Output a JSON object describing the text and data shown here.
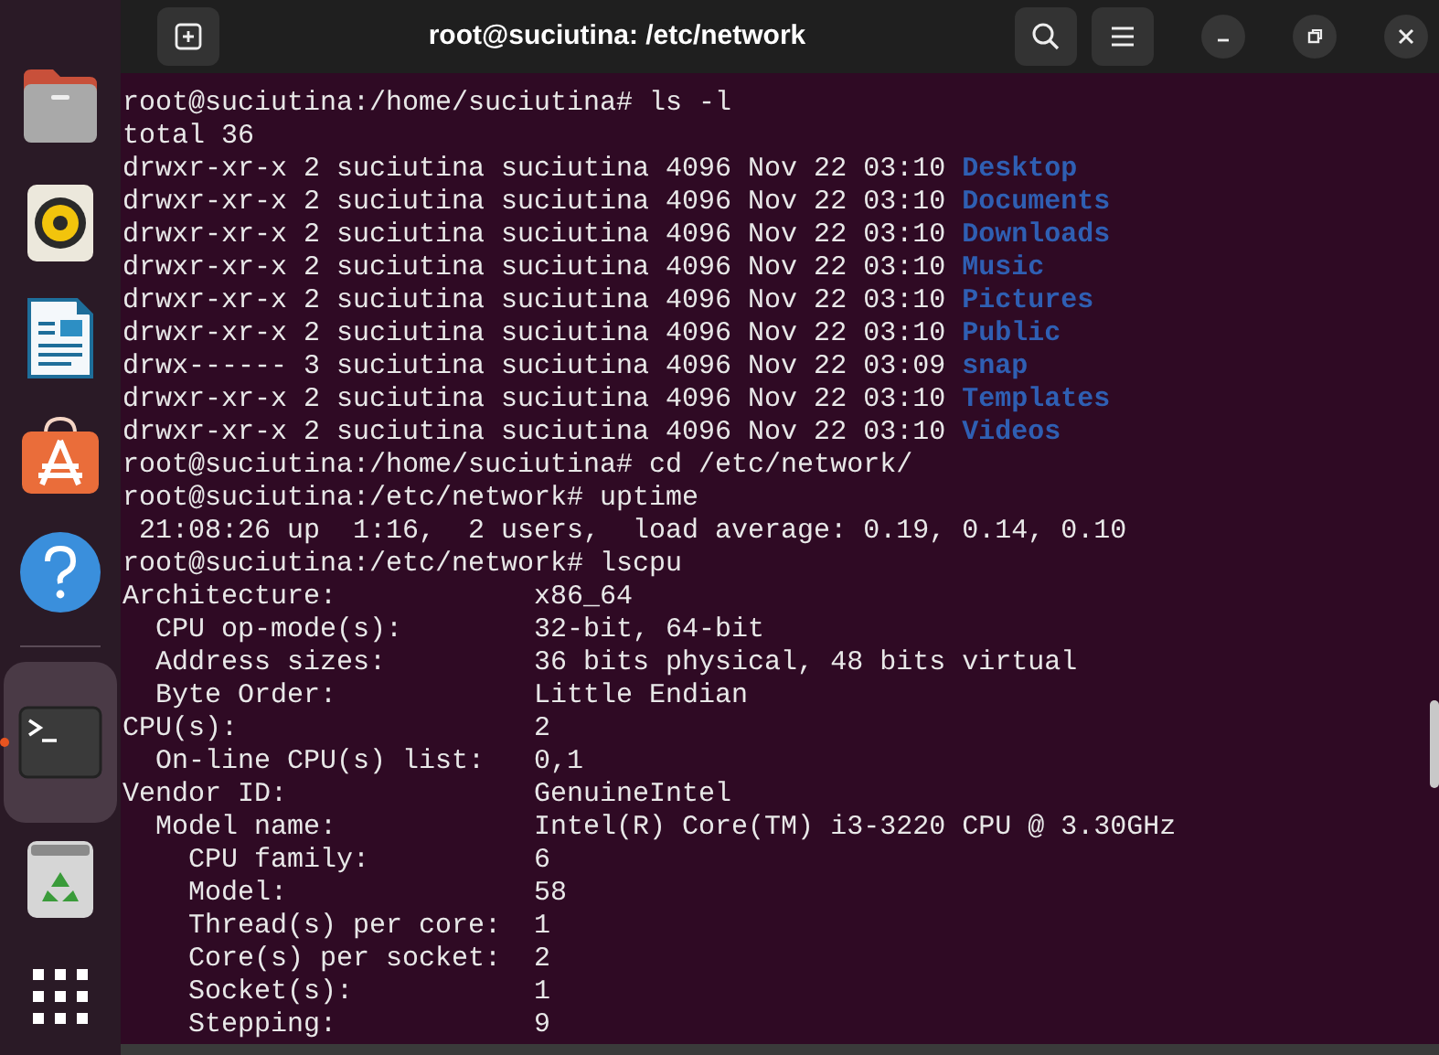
{
  "window": {
    "title": "root@suciutina: /etc/network"
  },
  "dock": [
    {
      "kind": "files",
      "selected": false
    },
    {
      "kind": "music",
      "selected": false
    },
    {
      "kind": "writer",
      "selected": false
    },
    {
      "kind": "store",
      "selected": false
    },
    {
      "kind": "help",
      "selected": false
    },
    {
      "kind": "separator"
    },
    {
      "kind": "terminal",
      "selected": true
    },
    {
      "kind": "trash",
      "selected": false
    },
    {
      "kind": "apps",
      "selected": false
    }
  ],
  "terminal": {
    "lines": [
      [
        {
          "text": "root@suciutina:/home/suciutina# ls -l",
          "kind": "plain"
        }
      ],
      [
        {
          "text": "total 36",
          "kind": "plain"
        }
      ],
      [
        {
          "text": "drwxr-xr-x 2 suciutina suciutina 4096 Nov 22 03:10 ",
          "kind": "plain"
        },
        {
          "text": "Desktop",
          "kind": "directory"
        }
      ],
      [
        {
          "text": "drwxr-xr-x 2 suciutina suciutina 4096 Nov 22 03:10 ",
          "kind": "plain"
        },
        {
          "text": "Documents",
          "kind": "directory"
        }
      ],
      [
        {
          "text": "drwxr-xr-x 2 suciutina suciutina 4096 Nov 22 03:10 ",
          "kind": "plain"
        },
        {
          "text": "Downloads",
          "kind": "directory"
        }
      ],
      [
        {
          "text": "drwxr-xr-x 2 suciutina suciutina 4096 Nov 22 03:10 ",
          "kind": "plain"
        },
        {
          "text": "Music",
          "kind": "directory"
        }
      ],
      [
        {
          "text": "drwxr-xr-x 2 suciutina suciutina 4096 Nov 22 03:10 ",
          "kind": "plain"
        },
        {
          "text": "Pictures",
          "kind": "directory"
        }
      ],
      [
        {
          "text": "drwxr-xr-x 2 suciutina suciutina 4096 Nov 22 03:10 ",
          "kind": "plain"
        },
        {
          "text": "Public",
          "kind": "directory"
        }
      ],
      [
        {
          "text": "drwx------ 3 suciutina suciutina 4096 Nov 22 03:09 ",
          "kind": "plain"
        },
        {
          "text": "snap",
          "kind": "directory"
        }
      ],
      [
        {
          "text": "drwxr-xr-x 2 suciutina suciutina 4096 Nov 22 03:10 ",
          "kind": "plain"
        },
        {
          "text": "Templates",
          "kind": "directory"
        }
      ],
      [
        {
          "text": "drwxr-xr-x 2 suciutina suciutina 4096 Nov 22 03:10 ",
          "kind": "plain"
        },
        {
          "text": "Videos",
          "kind": "directory"
        }
      ],
      [
        {
          "text": "root@suciutina:/home/suciutina# cd /etc/network/",
          "kind": "plain"
        }
      ],
      [
        {
          "text": "root@suciutina:/etc/network# uptime",
          "kind": "plain"
        }
      ],
      [
        {
          "text": " 21:08:26 up  1:16,  2 users,  load average: 0.19, 0.14, 0.10",
          "kind": "plain"
        }
      ],
      [
        {
          "text": "root@suciutina:/etc/network# lscpu",
          "kind": "plain"
        }
      ],
      [
        {
          "text": "Architecture:            x86_64",
          "kind": "plain"
        }
      ],
      [
        {
          "text": "  CPU op-mode(s):        32-bit, 64-bit",
          "kind": "plain"
        }
      ],
      [
        {
          "text": "  Address sizes:         36 bits physical, 48 bits virtual",
          "kind": "plain"
        }
      ],
      [
        {
          "text": "  Byte Order:            Little Endian",
          "kind": "plain"
        }
      ],
      [
        {
          "text": "CPU(s):                  2",
          "kind": "plain"
        }
      ],
      [
        {
          "text": "  On-line CPU(s) list:   0,1",
          "kind": "plain"
        }
      ],
      [
        {
          "text": "Vendor ID:               GenuineIntel",
          "kind": "plain"
        }
      ],
      [
        {
          "text": "  Model name:            Intel(R) Core(TM) i3-3220 CPU @ 3.30GHz",
          "kind": "plain"
        }
      ],
      [
        {
          "text": "    CPU family:          6",
          "kind": "plain"
        }
      ],
      [
        {
          "text": "    Model:               58",
          "kind": "plain"
        }
      ],
      [
        {
          "text": "    Thread(s) per core:  1",
          "kind": "plain"
        }
      ],
      [
        {
          "text": "    Core(s) per socket:  2",
          "kind": "plain"
        }
      ],
      [
        {
          "text": "    Socket(s):           1",
          "kind": "plain"
        }
      ],
      [
        {
          "text": "    Stepping:            9",
          "kind": "plain"
        }
      ]
    ]
  }
}
